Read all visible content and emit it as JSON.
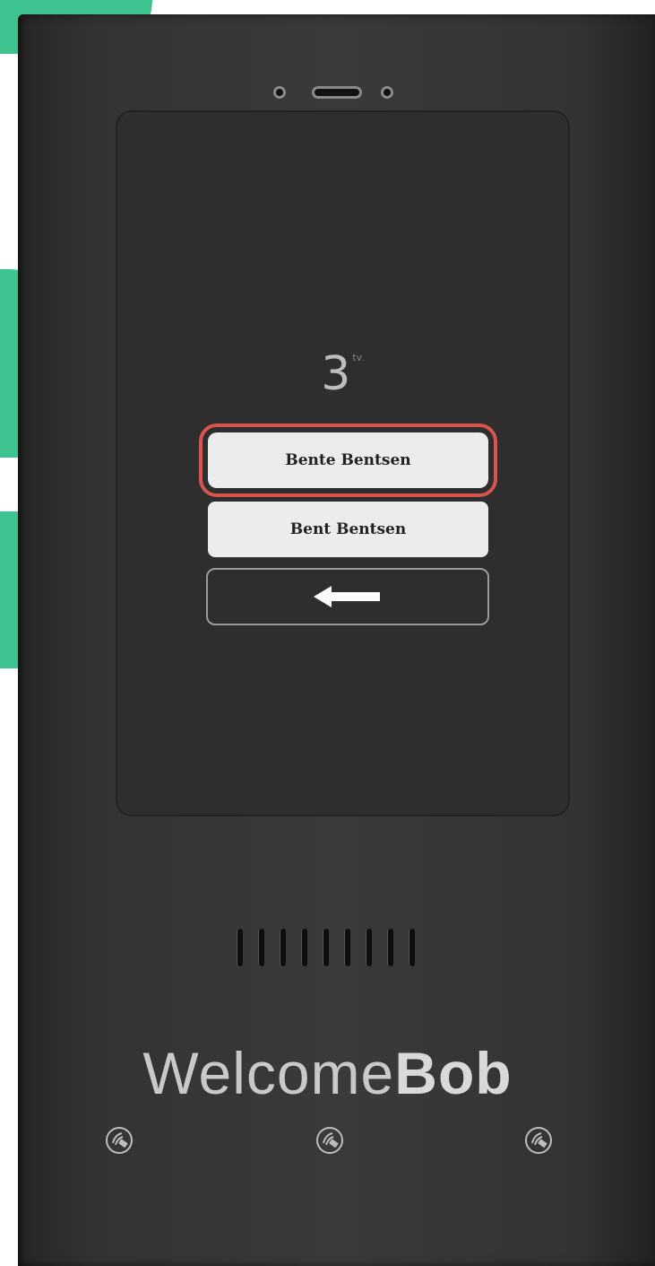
{
  "screen": {
    "floor_number": "3",
    "floor_suffix": "tv.",
    "residents": [
      {
        "name": "Bente Bentsen",
        "selected": true
      },
      {
        "name": "Bent Bentsen",
        "selected": false
      }
    ],
    "back_icon": "arrow-left-icon"
  },
  "brand": {
    "prefix": "Welcome",
    "suffix": "Bob"
  },
  "colors": {
    "accent_green": "#3ec28f",
    "highlight_red": "#d9534f",
    "panel": "#333333",
    "screen": "#2e2e2e"
  },
  "icons": [
    "nfc-icon",
    "nfc-icon",
    "nfc-icon"
  ]
}
